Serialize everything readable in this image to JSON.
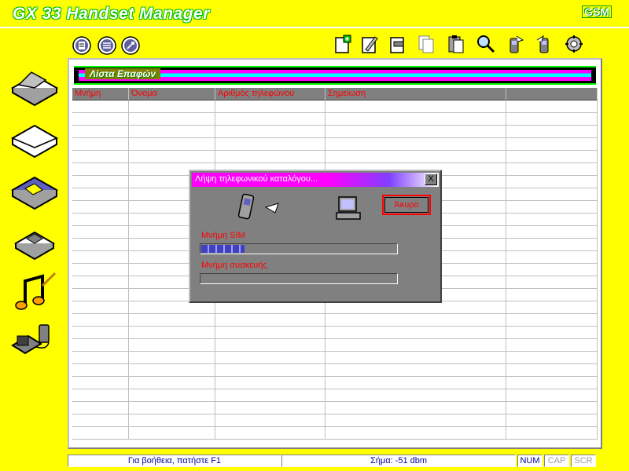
{
  "window": {
    "title": "GX 33 Handset Manager",
    "brand": "GSM"
  },
  "toolbar": {
    "left_buttons": [
      {
        "name": "download-icon"
      },
      {
        "name": "transfer-icon"
      },
      {
        "name": "settings-icon"
      }
    ],
    "right_buttons": [
      {
        "name": "add-entry-icon"
      },
      {
        "name": "edit-entry-icon"
      },
      {
        "name": "delete-entry-icon"
      },
      {
        "name": "copy-entry-icon"
      },
      {
        "name": "paste-entry-icon"
      },
      {
        "name": "search-icon"
      },
      {
        "name": "phone-to-pc-icon"
      },
      {
        "name": "pc-to-phone-icon"
      },
      {
        "name": "tools-icon"
      }
    ]
  },
  "sidebar": {
    "items": [
      {
        "name": "phonebook-icon"
      },
      {
        "name": "messages-icon"
      },
      {
        "name": "images-icon"
      },
      {
        "name": "backup-icon"
      },
      {
        "name": "melodies-icon"
      },
      {
        "name": "connection-icon"
      }
    ]
  },
  "panel": {
    "header_label": "Λίστα Επαφών"
  },
  "table": {
    "columns": [
      "Μνήμη",
      "Όνομα",
      "Αριθμός τηλεφώνου",
      "Σημείωση",
      ""
    ],
    "rows": []
  },
  "dialog": {
    "title": "Λήψη τηλεφωνικού καταλόγου...",
    "close_label": "X",
    "cancel_label": "Άκυρο",
    "sim_label": "Μνήμη SIM",
    "sim_progress": 0.22,
    "device_label": "Μνήμη συσκευής",
    "device_progress": 0.0
  },
  "statusbar": {
    "help": "Για βοήθεια, πατήστε F1",
    "signal": "Σήμα: -51 dbm",
    "num": "NUM",
    "cap": "CAP",
    "scr": "SCR"
  },
  "colors": {
    "background": "#ffff00",
    "header_text": "#ff0000",
    "dialog_title": "#ff00ff",
    "progress": "#4040c0"
  }
}
